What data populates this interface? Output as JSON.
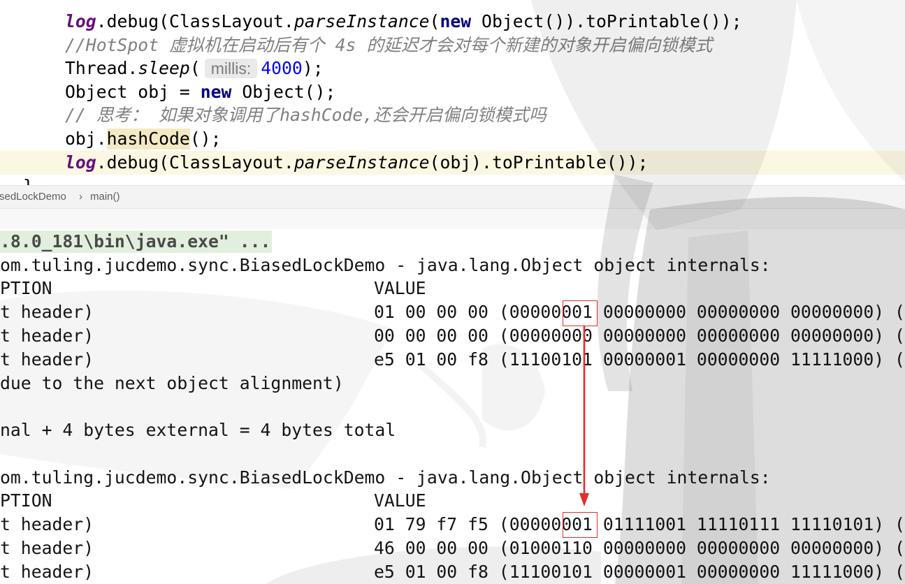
{
  "editor": {
    "lines": [
      {
        "field": "log",
        "call": ".debug(ClassLayout.",
        "static_method": "parseInstance",
        "open_paren": "(",
        "keyword": "new",
        "rest": " Object()).toPrintable());"
      },
      {
        "comment": "//HotSpot 虚拟机在启动后有个 4s 的延迟才会对每个新建的对象开启偏向锁模式"
      },
      {
        "receiver": "Thread.",
        "static_method": "sleep",
        "open_paren": "(",
        "param_hint": "millis:",
        "number": "4000",
        "rest": ");"
      },
      {
        "declaration": "Object obj = ",
        "keyword": "new",
        "rest": " Object();"
      },
      {
        "comment": "// 思考： 如果对象调用了hashCode,还会开启偏向锁模式吗"
      },
      {
        "receiver": "obj.",
        "method": "hashCode",
        "rest": "();"
      },
      {
        "field": "log",
        "call": ".debug(ClassLayout.",
        "static_method": "parseInstance",
        "rest": "(obj).toPrintable());"
      },
      {
        "brace": "}"
      }
    ]
  },
  "breadcrumb": {
    "class_name": "sedLockDemo",
    "separator": "›",
    "method_name": "main()"
  },
  "console": {
    "command_line": ".8.0_181\\bin\\java.exe\" ...",
    "dumps": [
      {
        "header": "om.tuling.jucdemo.sync.BiasedLockDemo - java.lang.Object object internals:",
        "column_description": "PTION",
        "column_value": "VALUE",
        "rows": [
          {
            "description": "t header)",
            "value": "01 00 00 00 (00000001 00000000 00000000 00000000) ("
          },
          {
            "description": "t header)",
            "value": "00 00 00 00 (00000000 00000000 00000000 00000000) ("
          },
          {
            "description": "t header)",
            "value": "e5 01 00 f8 (11100101 00000001 00000000 11111000) ("
          }
        ],
        "alignment_note": "due to the next object alignment)",
        "size_summary": "nal + 4 bytes external = 4 bytes total"
      },
      {
        "header": "om.tuling.jucdemo.sync.BiasedLockDemo - java.lang.Object object internals:",
        "column_description": "PTION",
        "column_value": "VALUE",
        "rows": [
          {
            "description": "t header)",
            "value": "01 79 f7 f5 (00000001 01111001 11110111 11110101) ("
          },
          {
            "description": "t header)",
            "value": "46 00 00 00 (01000110 00000000 00000000 00000000) ("
          },
          {
            "description": "t header)",
            "value": "e5 01 00 f8 (11100101 00000001 00000000 11111000) ("
          }
        ]
      }
    ]
  },
  "colors": {
    "keyword": "#000080",
    "field": "#660e7a",
    "comment": "#808080",
    "number": "#0000ff",
    "current_line_bg": "#fbf7e3",
    "usage_highlight": "#f3e9c2",
    "annotation_red": "#e0302c",
    "console_text": "#141414",
    "folded_bg": "#e3efde",
    "hint_bg": "#e9e9e9",
    "hint_text": "#7b7b7b",
    "breadcrumb_text": "#5e5e5e",
    "breadcrumb_bg": "#f3f3f3"
  }
}
